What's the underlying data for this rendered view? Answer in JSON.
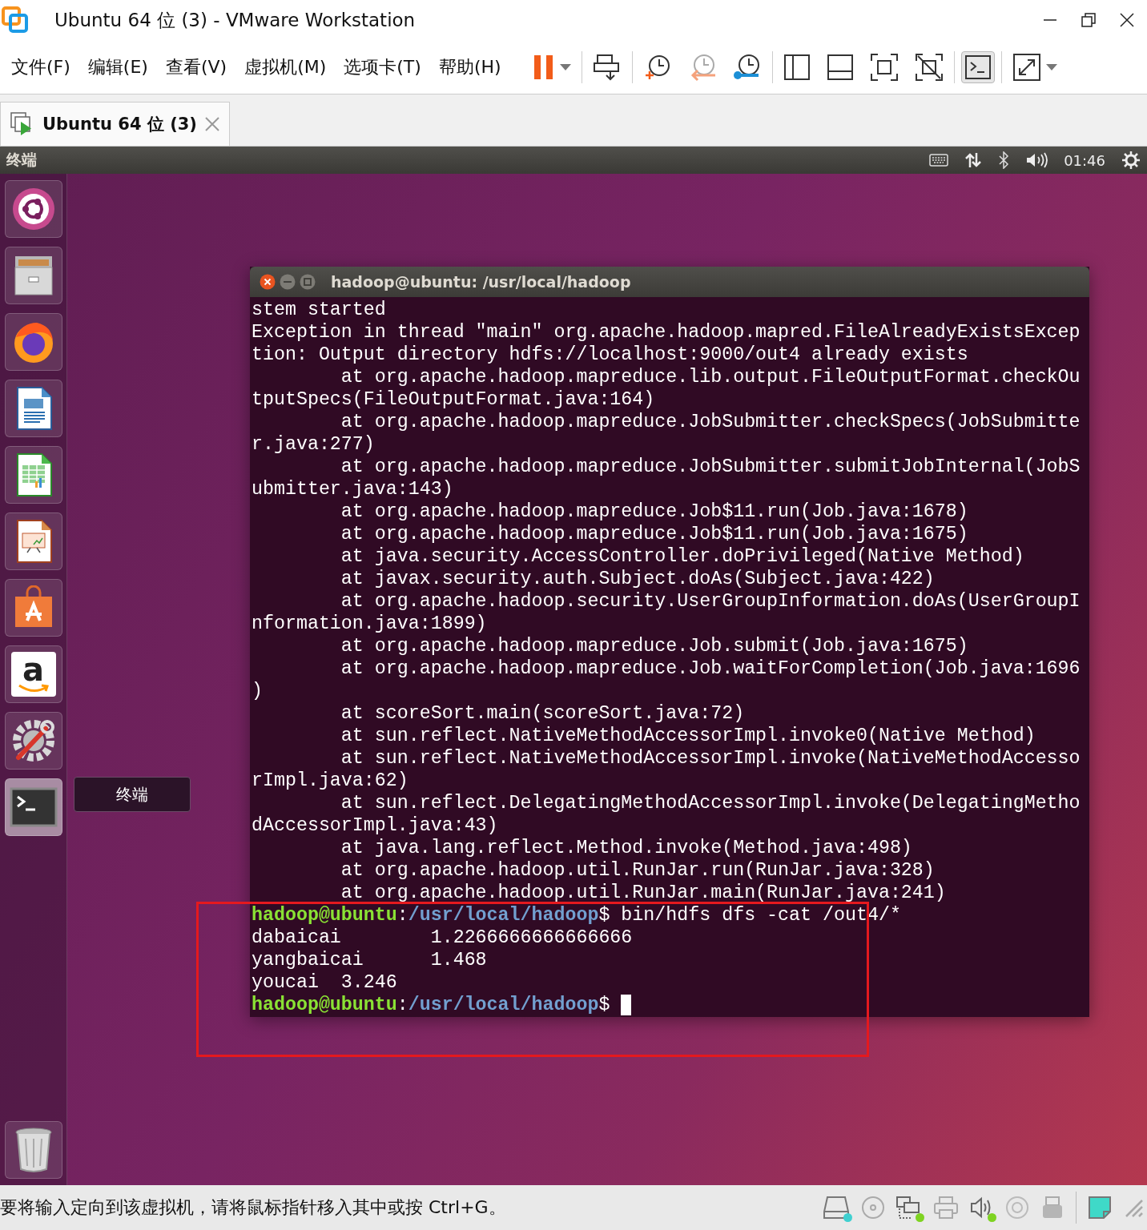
{
  "window": {
    "title": "Ubuntu 64 位 (3) - VMware Workstation"
  },
  "menu": [
    "文件(F)",
    "编辑(E)",
    "查看(V)",
    "虚拟机(M)",
    "选项卡(T)",
    "帮助(H)"
  ],
  "toolbar": [
    {
      "items": [
        {
          "kind": "pause",
          "dropdown": true,
          "selected": false
        }
      ]
    },
    {
      "items": [
        {
          "kind": "send-keys",
          "dropdown": false,
          "selected": false
        }
      ]
    },
    {
      "items": [
        {
          "kind": "snapshot",
          "dropdown": false,
          "selected": false
        },
        {
          "kind": "revert",
          "dropdown": false,
          "selected": false
        },
        {
          "kind": "manage",
          "dropdown": false,
          "selected": false
        }
      ]
    },
    {
      "items": [
        {
          "kind": "sidebar",
          "dropdown": false,
          "selected": false
        },
        {
          "kind": "thumbs",
          "dropdown": false,
          "selected": false
        },
        {
          "kind": "fullscreen",
          "dropdown": false,
          "selected": false
        },
        {
          "kind": "unity",
          "dropdown": false,
          "selected": false
        }
      ]
    },
    {
      "items": [
        {
          "kind": "console",
          "dropdown": false,
          "selected": true
        }
      ]
    },
    {
      "items": [
        {
          "kind": "stretch",
          "dropdown": true,
          "selected": false
        }
      ]
    }
  ],
  "tabs": [
    {
      "label": "Ubuntu 64 位 (3)",
      "selected": true
    }
  ],
  "panel": {
    "app_name": "终端",
    "time": "01:46"
  },
  "launcher": [
    {
      "kind": "dash",
      "focused": false
    },
    {
      "kind": "files",
      "focused": false
    },
    {
      "kind": "browser",
      "focused": false
    },
    {
      "kind": "writer",
      "focused": false
    },
    {
      "kind": "calc",
      "focused": false
    },
    {
      "kind": "impress",
      "focused": false
    },
    {
      "kind": "software",
      "focused": false
    },
    {
      "kind": "amazon",
      "glyph": "a",
      "focused": false
    },
    {
      "kind": "settings",
      "focused": false
    },
    {
      "kind": "terminal",
      "focused": true
    },
    {
      "kind": "trash",
      "focused": false
    }
  ],
  "tooltip": "终端",
  "terminal": {
    "title": "hadoop@ubuntu: /usr/local/hadoop",
    "lines": [
      {
        "kind": "text",
        "text": "stem started"
      },
      {
        "kind": "text",
        "text": "Exception in thread \"main\" org.apache.hadoop.mapred.FileAlreadyExistsExcep"
      },
      {
        "kind": "text",
        "text": "tion: Output directory hdfs://localhost:9000/out4 already exists"
      },
      {
        "kind": "text",
        "text": "        at org.apache.hadoop.mapreduce.lib.output.FileOutputFormat.checkOu"
      },
      {
        "kind": "text",
        "text": "tputSpecs(FileOutputFormat.java:164)"
      },
      {
        "kind": "text",
        "text": "        at org.apache.hadoop.mapreduce.JobSubmitter.checkSpecs(JobSubmitte"
      },
      {
        "kind": "text",
        "text": "r.java:277)"
      },
      {
        "kind": "text",
        "text": "        at org.apache.hadoop.mapreduce.JobSubmitter.submitJobInternal(JobS"
      },
      {
        "kind": "text",
        "text": "ubmitter.java:143)"
      },
      {
        "kind": "text",
        "text": "        at org.apache.hadoop.mapreduce.Job$11.run(Job.java:1678)"
      },
      {
        "kind": "text",
        "text": "        at org.apache.hadoop.mapreduce.Job$11.run(Job.java:1675)"
      },
      {
        "kind": "text",
        "text": "        at java.security.AccessController.doPrivileged(Native Method)"
      },
      {
        "kind": "text",
        "text": "        at javax.security.auth.Subject.doAs(Subject.java:422)"
      },
      {
        "kind": "text",
        "text": "        at org.apache.hadoop.security.UserGroupInformation.doAs(UserGroupI"
      },
      {
        "kind": "text",
        "text": "nformation.java:1899)"
      },
      {
        "kind": "text",
        "text": "        at org.apache.hadoop.mapreduce.Job.submit(Job.java:1675)"
      },
      {
        "kind": "text",
        "text": "        at org.apache.hadoop.mapreduce.Job.waitForCompletion(Job.java:1696"
      },
      {
        "kind": "text",
        "text": ")"
      },
      {
        "kind": "text",
        "text": "        at scoreSort.main(scoreSort.java:72)"
      },
      {
        "kind": "text",
        "text": "        at sun.reflect.NativeMethodAccessorImpl.invoke0(Native Method)"
      },
      {
        "kind": "text",
        "text": "        at sun.reflect.NativeMethodAccessorImpl.invoke(NativeMethodAccesso"
      },
      {
        "kind": "text",
        "text": "rImpl.java:62)"
      },
      {
        "kind": "text",
        "text": "        at sun.reflect.DelegatingMethodAccessorImpl.invoke(DelegatingMetho"
      },
      {
        "kind": "text",
        "text": "dAccessorImpl.java:43)"
      },
      {
        "kind": "text",
        "text": "        at java.lang.reflect.Method.invoke(Method.java:498)"
      },
      {
        "kind": "text",
        "text": "        at org.apache.hadoop.util.RunJar.run(RunJar.java:328)"
      },
      {
        "kind": "text",
        "text": "        at org.apache.hadoop.util.RunJar.main(RunJar.java:241)"
      },
      {
        "kind": "prompt",
        "user": "hadoop@ubuntu",
        "colon": ":",
        "path": "/usr/local/hadoop",
        "rest": "$ bin/hdfs dfs -cat /out4/*",
        "cursor": false
      },
      {
        "kind": "text",
        "text": "dabaicai        1.2266666666666666"
      },
      {
        "kind": "text",
        "text": "yangbaicai      1.468"
      },
      {
        "kind": "text",
        "text": "youcai  3.246"
      },
      {
        "kind": "prompt",
        "user": "hadoop@ubuntu",
        "colon": ":",
        "path": "/usr/local/hadoop",
        "rest": "$ ",
        "cursor": true
      }
    ]
  },
  "highlight": true,
  "status_bar": {
    "message": "要将输入定向到该虚拟机，请将鼠标指针移入其中或按 Ctrl+G。",
    "devices": [
      {
        "kind": "disk",
        "active": true
      },
      {
        "kind": "cd",
        "active": false
      },
      {
        "kind": "network",
        "active": true
      },
      {
        "kind": "printer",
        "active": false
      },
      {
        "kind": "sound",
        "active": true
      },
      {
        "kind": "camera",
        "active": false
      },
      {
        "kind": "usb",
        "active": false
      }
    ]
  }
}
